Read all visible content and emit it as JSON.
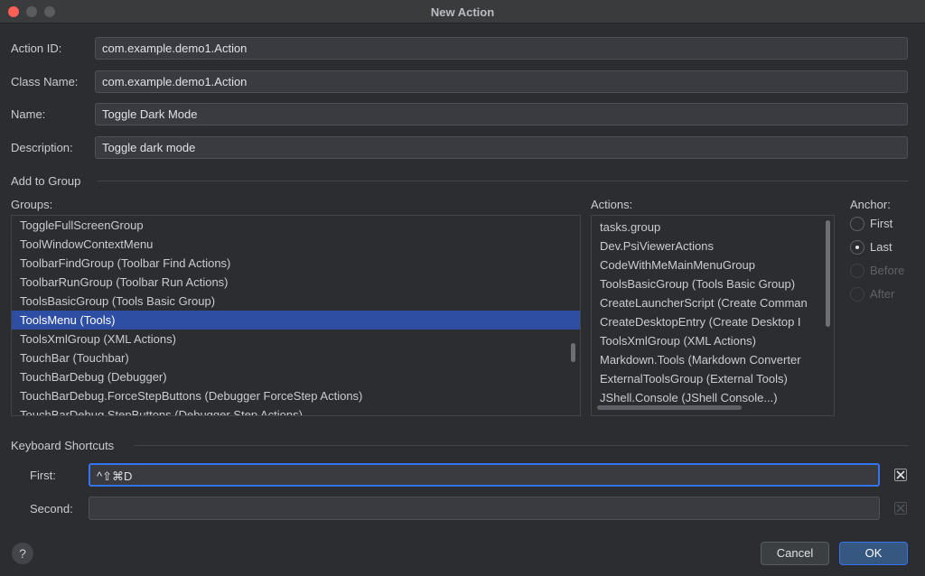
{
  "window": {
    "title": "New Action"
  },
  "fields": {
    "action_id": {
      "label": "Action ID:",
      "value": "com.example.demo1.Action"
    },
    "class_name": {
      "label": "Class Name:",
      "value": "com.example.demo1.Action"
    },
    "name": {
      "label": "Name:",
      "value": "Toggle Dark Mode"
    },
    "description": {
      "label": "Description:",
      "value": "Toggle dark mode"
    }
  },
  "add_to_group": {
    "section_label": "Add to Group",
    "groups_label": "Groups:",
    "groups": [
      "ToggleFullScreenGroup",
      "ToolWindowContextMenu",
      "ToolbarFindGroup (Toolbar Find Actions)",
      "ToolbarRunGroup (Toolbar Run Actions)",
      "ToolsBasicGroup (Tools Basic Group)",
      "ToolsMenu (Tools)",
      "ToolsXmlGroup (XML Actions)",
      "TouchBar (Touchbar)",
      "TouchBarDebug (Debugger)",
      "TouchBarDebug.ForceStepButtons (Debugger ForceStep Actions)",
      "TouchBarDebug.StepButtons (Debugger Step Actions)"
    ],
    "selected_group": "ToolsMenu (Tools)",
    "actions_label": "Actions:",
    "actions": [
      "tasks.group",
      "Dev.PsiViewerActions",
      "CodeWithMeMainMenuGroup",
      "ToolsBasicGroup (Tools Basic Group)",
      "CreateLauncherScript (Create Comman",
      "CreateDesktopEntry (Create Desktop I",
      "ToolsXmlGroup (XML Actions)",
      "Markdown.Tools (Markdown Converter",
      "ExternalToolsGroup (External Tools)",
      "JShell.Console (JShell Console...)"
    ],
    "anchor_label": "Anchor:",
    "anchor_options": [
      {
        "label": "First",
        "enabled": true
      },
      {
        "label": "Last",
        "enabled": true
      },
      {
        "label": "Before",
        "enabled": false
      },
      {
        "label": "After",
        "enabled": false
      }
    ],
    "anchor_selected": "Last"
  },
  "keyboard_shortcuts": {
    "section_label": "Keyboard Shortcuts",
    "first_label": "First:",
    "first_value": "^⇧⌘D",
    "second_label": "Second:",
    "second_value": ""
  },
  "buttons": {
    "help": "?",
    "cancel": "Cancel",
    "ok": "OK"
  },
  "colors": {
    "accent": "#3574f0",
    "selection": "#2e4ea4",
    "background": "#2b2d30"
  }
}
